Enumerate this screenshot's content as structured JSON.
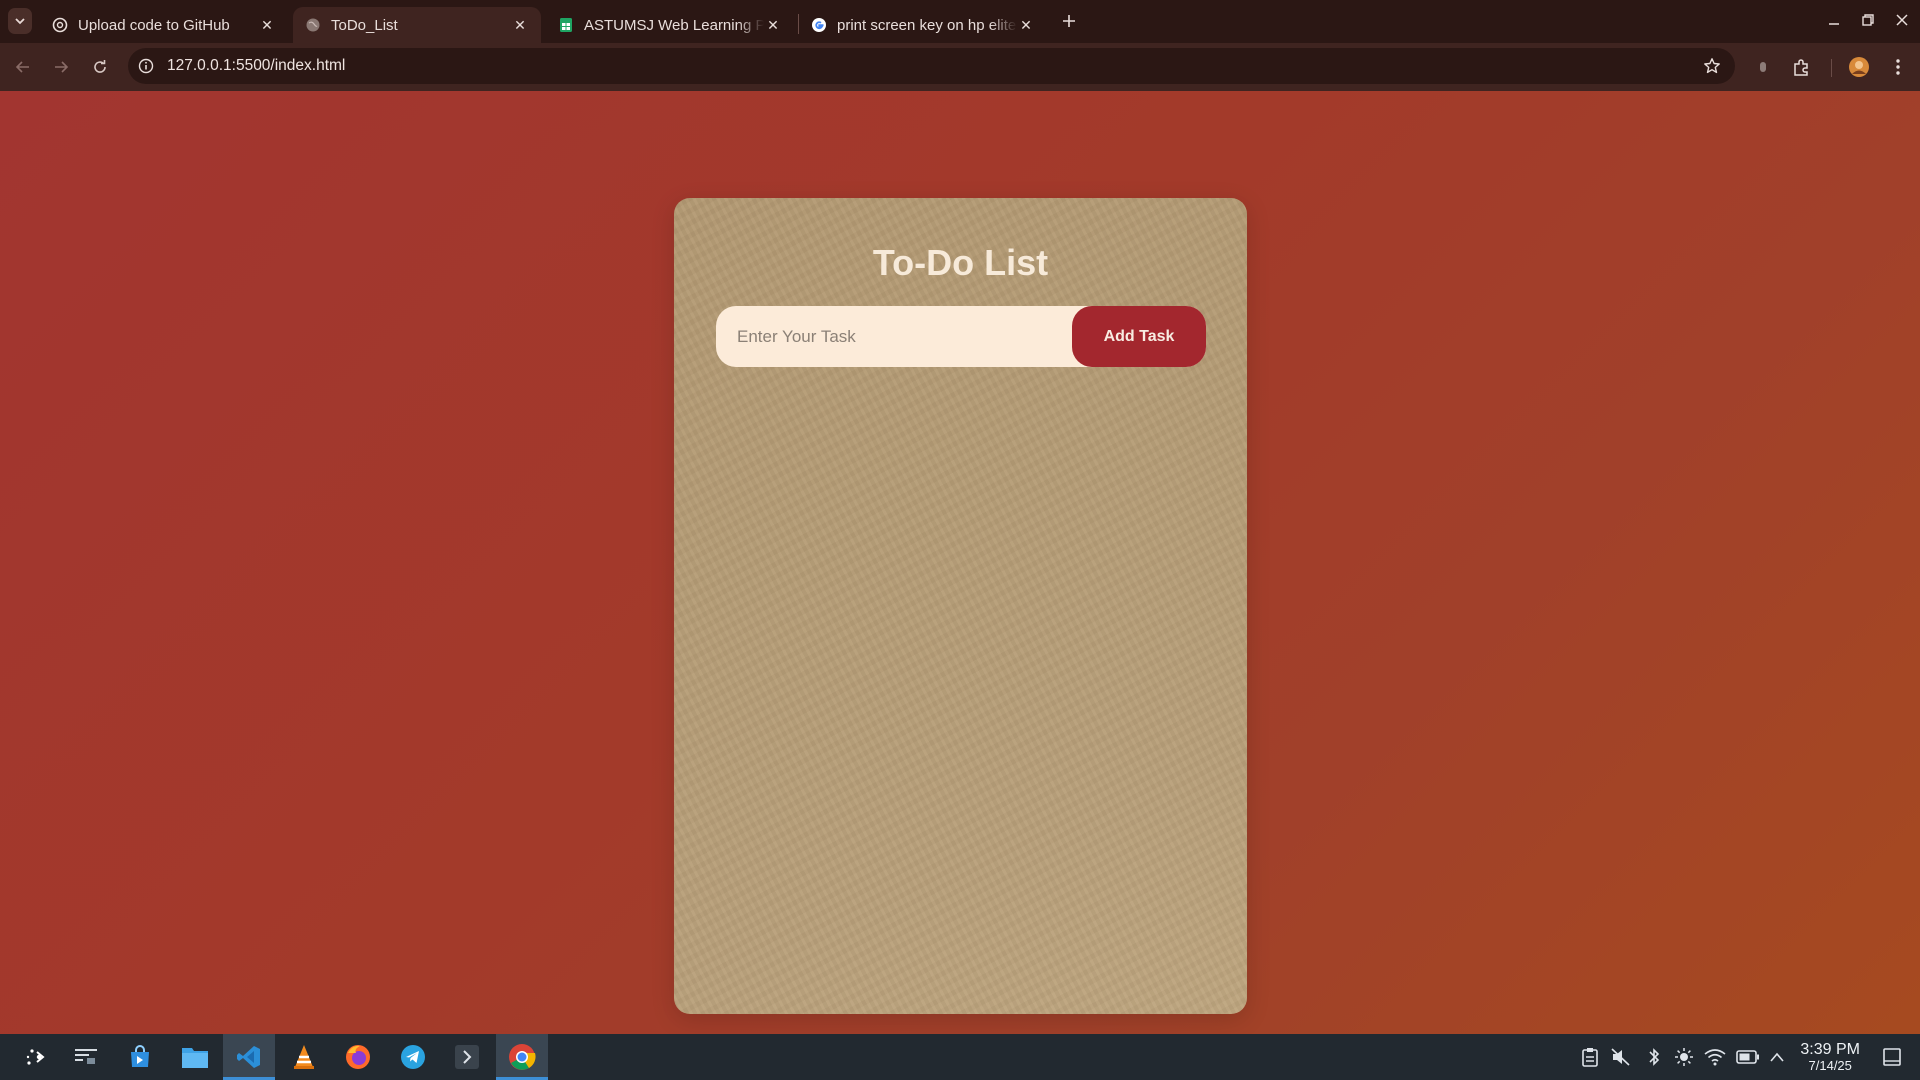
{
  "browser": {
    "tabs": [
      {
        "title": "Upload code to GitHub",
        "icon": "openai-icon",
        "active": false
      },
      {
        "title": "ToDo_List",
        "icon": "globe-icon",
        "active": true
      },
      {
        "title": "ASTUMSJ Web Learning Pat",
        "icon": "sheets-icon",
        "active": false
      },
      {
        "title": "print screen key on hp elite",
        "icon": "google-icon",
        "active": false
      }
    ],
    "url": "127.0.0.1:5500/index.html"
  },
  "app": {
    "title": "To-Do List",
    "input_placeholder": "Enter Your Task",
    "input_value": "",
    "add_button_label": "Add Task",
    "tasks": []
  },
  "colors": {
    "page_gradient_start": "#a23530",
    "page_gradient_end": "#a64a20",
    "card": "#b69d76",
    "input_bg": "#fcebd9",
    "button": "#a3272e",
    "title_text": "#f7ead9"
  },
  "taskbar": {
    "apps": [
      "launcher-icon",
      "task-manager-icon",
      "store-icon",
      "files-icon",
      "vscode-icon",
      "vlc-icon",
      "firefox-icon",
      "telegram-icon",
      "terminal-icon",
      "chrome-icon"
    ],
    "active_app": "chrome-icon",
    "tray": [
      "clipboard-icon",
      "volume-muted-icon",
      "bluetooth-icon",
      "brightness-icon",
      "wifi-icon",
      "battery-icon",
      "tray-expand-icon"
    ],
    "time": "3:39 PM",
    "date": "7/14/25"
  }
}
